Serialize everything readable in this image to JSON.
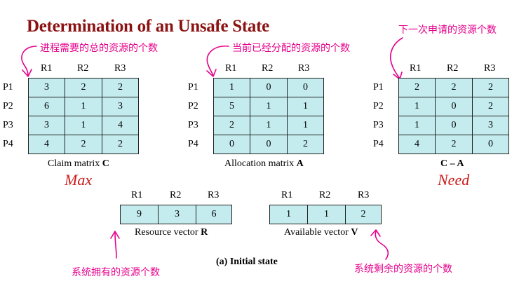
{
  "title": "Determination of an Unsafe State",
  "annotations": {
    "claim_note": "进程需要的总的资源的个数",
    "alloc_note": "当前已经分配的资源的个数",
    "need_note": "下一次申请的资源个数",
    "resource_note": "系统拥有的资源个数",
    "available_note": "系统剩余的资源的个数"
  },
  "labels": {
    "max": "Max",
    "need": "Need"
  },
  "columns": [
    "R1",
    "R2",
    "R3"
  ],
  "rows": [
    "P1",
    "P2",
    "P3",
    "P4"
  ],
  "claim": {
    "caption": "Claim matrix ",
    "symbol": "C",
    "values": [
      [
        3,
        2,
        2
      ],
      [
        6,
        1,
        3
      ],
      [
        3,
        1,
        4
      ],
      [
        4,
        2,
        2
      ]
    ]
  },
  "allocation": {
    "caption": "Allocation matrix ",
    "symbol": "A",
    "values": [
      [
        1,
        0,
        0
      ],
      [
        5,
        1,
        1
      ],
      [
        2,
        1,
        1
      ],
      [
        0,
        0,
        2
      ]
    ]
  },
  "need": {
    "caption": "",
    "symbol": "C – A",
    "values": [
      [
        2,
        2,
        2
      ],
      [
        1,
        0,
        2
      ],
      [
        1,
        0,
        3
      ],
      [
        4,
        2,
        0
      ]
    ]
  },
  "resource": {
    "caption": "Resource vector ",
    "symbol": "R",
    "values": [
      9,
      3,
      6
    ]
  },
  "available": {
    "caption": "Available vector ",
    "symbol": "V",
    "values": [
      1,
      1,
      2
    ]
  },
  "footer": "(a) Initial state",
  "colors": {
    "cell_fill": "#c4ecef",
    "title": "#8b1212",
    "annotation": "#e6008c",
    "italic_label": "#cc1a1a"
  }
}
